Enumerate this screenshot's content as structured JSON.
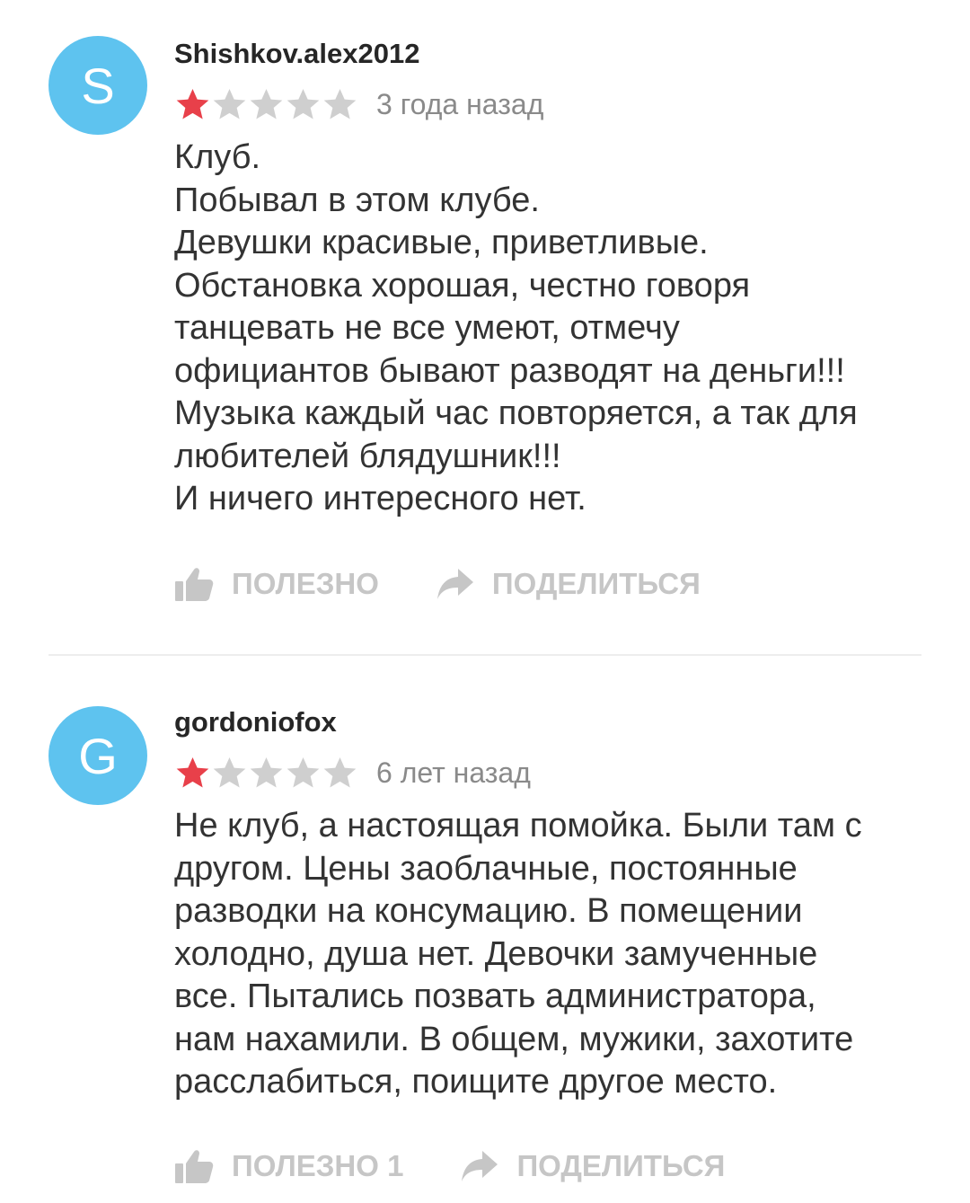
{
  "colors": {
    "avatar_bg": "#5ec3ef",
    "star_filled": "#e8404a",
    "star_empty": "#cfcfcf",
    "action": "#c6c6c6",
    "divider": "#ededed"
  },
  "reviews": [
    {
      "avatar_letter": "S",
      "author": "Shishkov.alex2012",
      "rating": 1,
      "max_rating": 5,
      "date": "3 года назад",
      "text": "Клуб.\nПобывал в этом клубе.\nДевушки красивые, приветливые.\nОбстановка хорошая, честно говоря\nтанцевать не все умеют, отмечу\nофициантов бывают разводят на деньги!!!\nМузыка каждый час повторяется, а так для\nлюбителей блядушник!!!\nИ ничего интересного нет.",
      "helpful_label": "ПОЛЕЗНО",
      "share_label": "ПОДЕЛИТЬСЯ",
      "helpful_icon": "thumbs-up-icon",
      "share_icon": "share-arrow-icon"
    },
    {
      "avatar_letter": "G",
      "author": "gordoniofox",
      "rating": 1,
      "max_rating": 5,
      "date": "6 лет назад",
      "text": "Не клуб, а настоящая помойка. Были там с\nдругом. Цены заоблачные, постоянные\nразводки на консумацию. В помещении\nхолодно, душа нет. Девочки замученные\nвсе. Пытались позвать администратора,\nнам нахамили. В общем, мужики, захотите\nрасслабиться, поищите другое место.",
      "helpful_label": "ПОЛЕЗНО 1",
      "share_label": "ПОДЕЛИТЬСЯ",
      "helpful_icon": "thumbs-up-icon",
      "share_icon": "share-arrow-icon"
    }
  ]
}
